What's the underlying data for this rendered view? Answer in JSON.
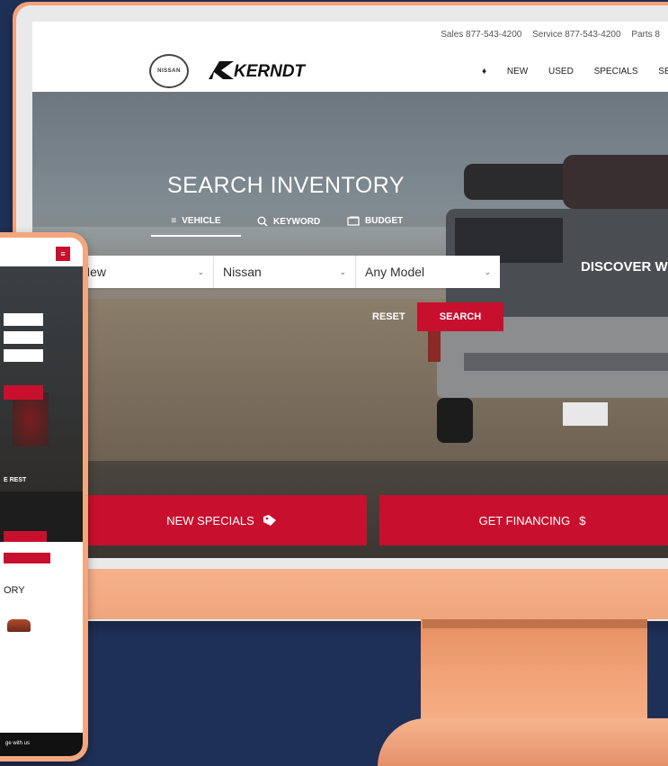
{
  "topbar": {
    "contacts": [
      "Sales 877-543-4200",
      "Service 877-543-4200",
      "Parts 8"
    ]
  },
  "header": {
    "nissan_logo_text": "NISSAN",
    "dealer_logo_text": "KERNDT",
    "nav": [
      "NEW",
      "USED",
      "SPECIALS",
      "SEI"
    ]
  },
  "hero": {
    "title": "SEARCH INVENTORY",
    "tabs": [
      {
        "label": "VEHICLE",
        "icon": "sliders-icon",
        "active": true
      },
      {
        "label": "KEYWORD",
        "icon": "search-icon",
        "active": false
      },
      {
        "label": "BUDGET",
        "icon": "money-icon",
        "active": false
      }
    ],
    "selects": [
      {
        "value": "New"
      },
      {
        "value": "Nissan"
      },
      {
        "value": "Any Model"
      }
    ],
    "reset_label": "RESET",
    "search_label": "SEARCH",
    "discover_text": "DISCOVER W"
  },
  "cta": {
    "specials_label": "NEW SPECIALS",
    "financing_label": "GET FINANCING",
    "financing_icon": "$"
  },
  "phone": {
    "menu_icon": "≡",
    "rest_text": "E REST",
    "inventory_text": "ORY",
    "footer_text": "ge with us"
  },
  "colors": {
    "accent": "#c8102e",
    "background": "#1f3057",
    "device": "#f2a77e"
  }
}
